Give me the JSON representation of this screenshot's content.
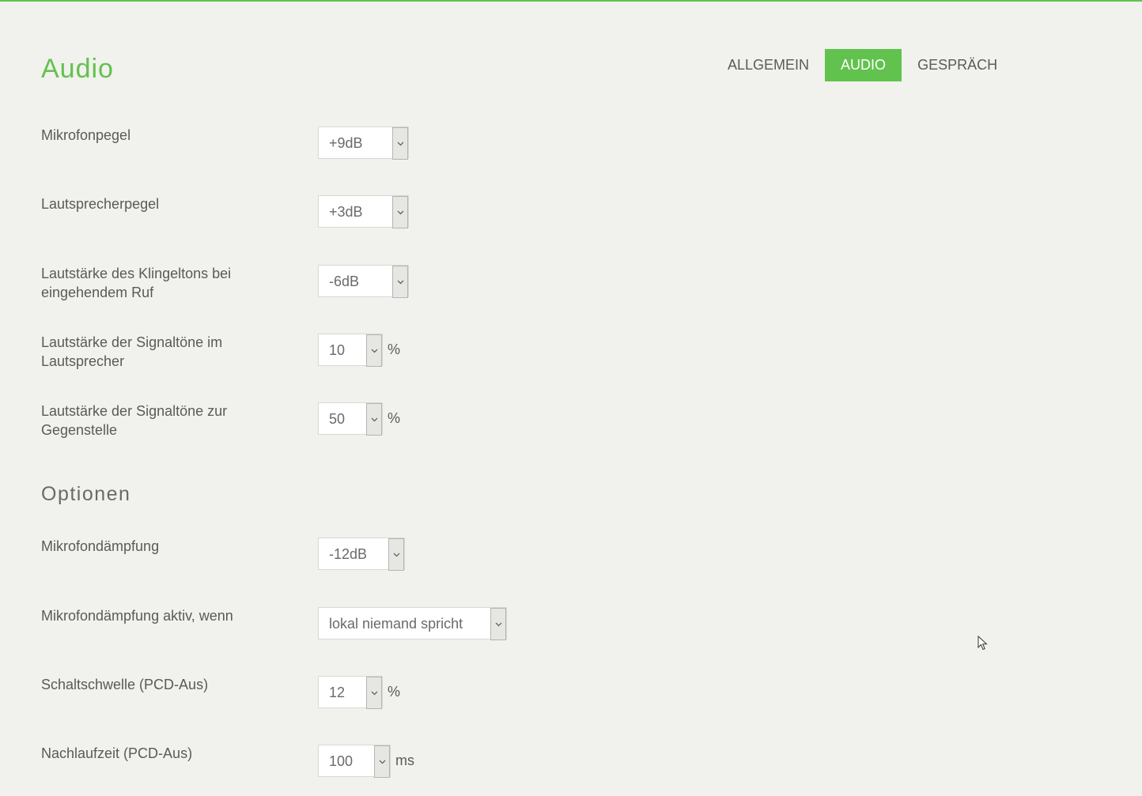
{
  "page": {
    "title": "Audio"
  },
  "tabs": [
    {
      "label": "ALLGEMEIN",
      "active": false
    },
    {
      "label": "AUDIO",
      "active": true
    },
    {
      "label": "GESPRÄCH",
      "active": false
    }
  ],
  "settings": {
    "mic_level": {
      "label": "Mikrofonpegel",
      "value": "+9dB"
    },
    "speaker_level": {
      "label": "Lautsprecherpegel",
      "value": "+3dB"
    },
    "ring_volume": {
      "label": "Lautstärke des Klingeltons bei eingehendem Ruf",
      "value": "-6dB"
    },
    "signal_speaker": {
      "label": "Lautstärke der Signaltöne im Lautsprecher",
      "value": "10",
      "unit": "%"
    },
    "signal_remote": {
      "label": "Lautstärke der Signaltöne zur Gegenstelle",
      "value": "50",
      "unit": "%"
    }
  },
  "options": {
    "title": "Optionen",
    "mic_attenuation": {
      "label": "Mikrofondämpfung",
      "value": "-12dB"
    },
    "mic_attenuation_active": {
      "label": "Mikrofondämpfung aktiv, wenn",
      "value": "lokal niemand spricht"
    },
    "threshold": {
      "label": "Schaltschwelle (PCD-Aus)",
      "value": "12",
      "unit": "%"
    },
    "hold_time": {
      "label": "Nachlaufzeit (PCD-Aus)",
      "value": "100",
      "unit": "ms"
    }
  },
  "colors": {
    "accent": "#62c24e",
    "background": "#f1f1ed"
  },
  "icons": {
    "dropdown": "chevron-down-icon",
    "cursor": "mouse-pointer-icon"
  }
}
